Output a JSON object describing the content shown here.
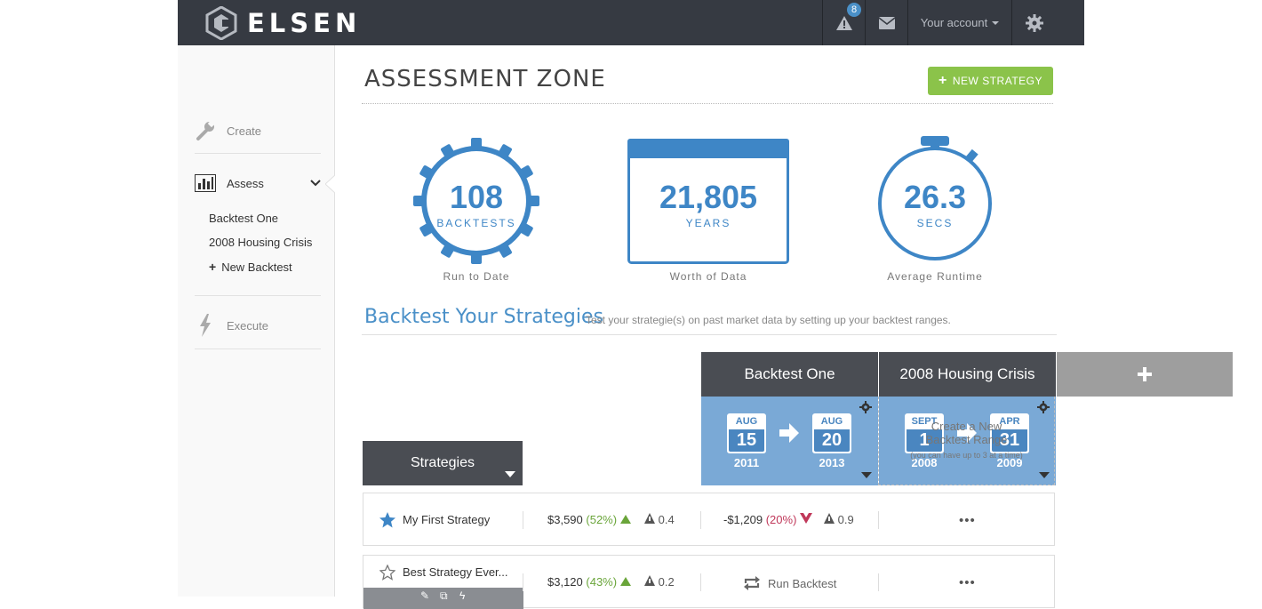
{
  "header": {
    "brand": "ELSEN",
    "alerts_count": "8",
    "account_label": "Your account",
    "icons": [
      "warning-icon",
      "envelope-icon",
      "gear-icon"
    ]
  },
  "sidebar": {
    "create_label": "Create",
    "assess_label": "Assess",
    "execute_label": "Execute",
    "backtests": [
      "Backtest One",
      "2008 Housing Crisis"
    ],
    "new_backtest_label": "New Backtest"
  },
  "main": {
    "title": "ASSESSMENT ZONE",
    "new_strategy_label": "NEW STRATEGY",
    "stats": [
      {
        "value": "108",
        "unit": "BACKTESTS",
        "caption": "Run to Date"
      },
      {
        "value": "21,805",
        "unit": "YEARS",
        "caption": "Worth of Data"
      },
      {
        "value": "26.3",
        "unit": "SECS",
        "caption": "Average Runtime"
      }
    ],
    "section_title": "Backtest Your Strategies",
    "section_subtitle": "Test your strategie(s) on past market data by setting up your backtest ranges."
  },
  "backtests": [
    {
      "name": "Backtest One",
      "start": {
        "month": "AUG",
        "day": "15",
        "year": "2011"
      },
      "end": {
        "month": "AUG",
        "day": "20",
        "year": "2013"
      }
    },
    {
      "name": "2008 Housing Crisis",
      "start": {
        "month": "SEPT",
        "day": "1",
        "year": "2008"
      },
      "end": {
        "month": "APR",
        "day": "31",
        "year": "2009"
      }
    }
  ],
  "create_new": {
    "line1": "Create a New",
    "line2": "Backtest Range",
    "note": "(you can have up to 3 at a time)"
  },
  "strategies_label": "Strategies",
  "strategies": [
    {
      "name": "My First Strategy",
      "starred": true,
      "bt1_value": "$3,590",
      "bt1_pct": "(52%)",
      "bt1_risk": "0.4",
      "bt2_value": "-$1,209",
      "bt2_pct": "(20%)",
      "bt2_risk": "0.9"
    },
    {
      "name": "Best Strategy Ever...",
      "starred": false,
      "bt1_value": "$3,120",
      "bt1_pct": "(43%)",
      "bt1_risk": "0.2",
      "run_backtest_label": "Run Backtest"
    }
  ],
  "colors": {
    "topbar": "#363a42",
    "accent_blue": "#3e86c6",
    "range_blue": "#7aa9d6",
    "header_dark": "#4a4d53",
    "green_button": "#8bc34a",
    "positive": "#6aa53a",
    "negative": "#c0385a"
  }
}
